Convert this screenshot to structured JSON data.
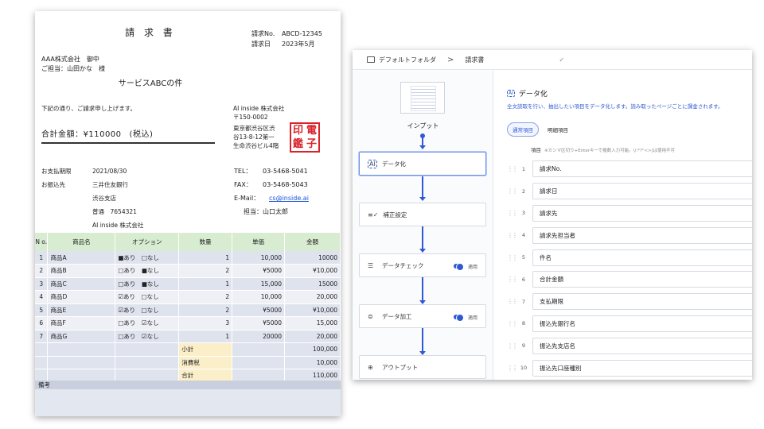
{
  "invoice": {
    "title": "請 求 書",
    "meta": [
      {
        "label": "請求No.",
        "value": "ABCD-12345"
      },
      {
        "label": "請求日",
        "value": "2023年5月"
      }
    ],
    "recipient_company": "AAA株式会社　御中",
    "recipient_person": "ご担当：山田かな　様",
    "subject": "サービスABCの件",
    "greeting": "下記の通り、ご請求申し上げます。",
    "total_label": "合計金額：¥110000",
    "total_tax": "(税込)",
    "issuer_name": "AI inside 株式会社",
    "issuer_zip": "〒150-0002",
    "issuer_addr1": "東京都渋谷区渋",
    "issuer_addr2": "谷13-8-12第一",
    "issuer_addr3": "生命渋谷ビル4階",
    "seal": [
      "印",
      "電",
      "鑑",
      "子"
    ],
    "payment": [
      {
        "label": "お支払期限",
        "value": "2021/08/30"
      },
      {
        "label": "お振込先",
        "value": "三井住友銀行"
      },
      {
        "label": "",
        "value": "渋谷支店"
      },
      {
        "label": "",
        "value": "普通　7654321"
      },
      {
        "label": "",
        "value": "AI inside 株式会社"
      }
    ],
    "contact": [
      {
        "label": "TEL：",
        "value": "03-5468-5041",
        "link": false
      },
      {
        "label": "FAX：",
        "value": "03-5468-5043",
        "link": false
      },
      {
        "label": "E-Mail：",
        "value": "cs@inside.ai",
        "link": true
      },
      {
        "label": "担当：",
        "value": "山口太郎",
        "link": false
      }
    ],
    "table": {
      "headers": [
        "N o.",
        "商品名",
        "オプション",
        "数量",
        "単価",
        "金額"
      ],
      "rows": [
        [
          "1",
          "商品A",
          "■あり　□なし",
          "1",
          "10,000",
          "10000"
        ],
        [
          "2",
          "商品B",
          "□あり　■なし",
          "2",
          "¥5000",
          "¥10,000"
        ],
        [
          "3",
          "商品C",
          "□あり　■なし",
          "1",
          "15,000",
          "15000"
        ],
        [
          "4",
          "商品D",
          "☑あり　□なし",
          "2",
          "10,000",
          "20,000"
        ],
        [
          "5",
          "商品E",
          "☑あり　□なし",
          "2",
          "¥5000",
          "¥10,000"
        ],
        [
          "6",
          "商品F",
          "□あり　☑なし",
          "3",
          "¥5000",
          "15,000"
        ],
        [
          "7",
          "商品G",
          "□あり　☑なし",
          "1",
          "20000",
          "20,000"
        ]
      ],
      "summary": [
        {
          "label": "小計",
          "value": "100,000"
        },
        {
          "label": "消費税",
          "value": "10,000"
        },
        {
          "label": "合計",
          "value": "110,000"
        }
      ]
    },
    "memo_label": "備考"
  },
  "app": {
    "breadcrumb_folder": "デフォルトフォルダ",
    "breadcrumb_sep": ">",
    "breadcrumb_doc": "請求書",
    "flow": {
      "input_label": "インプット",
      "steps": [
        {
          "label": "データ化",
          "icon": "ai-icon",
          "icon_glyph": "AI",
          "toggle": false
        },
        {
          "label": "補正設定",
          "icon": "correction-icon",
          "icon_glyph": "≡✓",
          "toggle": false
        },
        {
          "label": "データチェック",
          "icon": "checklist-icon",
          "icon_glyph": "☰",
          "toggle": true,
          "toggle_label": "適用"
        },
        {
          "label": "データ加工",
          "icon": "process-icon",
          "icon_glyph": "⊜",
          "toggle": true,
          "toggle_label": "適用"
        },
        {
          "label": "アウトプット",
          "icon": "output-icon",
          "icon_glyph": "⊕",
          "toggle": false
        }
      ]
    },
    "panel": {
      "title": "データ化",
      "description": "全文読取を行い、抽出したい項目をデータ化します。読み取ったページごとに課金されます。",
      "tabs": [
        "通常項目",
        "明細項目"
      ],
      "field_header": "項目",
      "field_hint": "※カンマ区切り+Enterキーで複数入力可能。\\/:*?\"<>|は使用不可",
      "fields": [
        "請求No.",
        "請求日",
        "請求先",
        "請求先担当者",
        "件名",
        "合計金額",
        "支払期限",
        "振込先銀行名",
        "振込先支店名",
        "振込先口座種別"
      ]
    },
    "accent_color": "#2f58d6"
  }
}
